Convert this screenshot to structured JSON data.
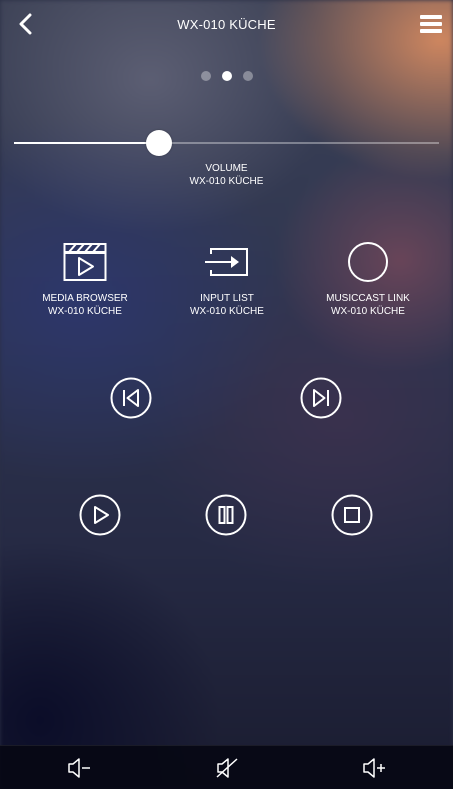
{
  "header": {
    "title": "WX-010 KÜCHE"
  },
  "pager": {
    "count": 3,
    "active_index": 1
  },
  "volume": {
    "level": 0.34,
    "label_line1": "VOLUME",
    "label_line2": "WX-010 KÜCHE"
  },
  "sources": [
    {
      "line1": "MEDIA BROWSER",
      "line2": "WX-010 KÜCHE",
      "icon": "clapperboard-icon"
    },
    {
      "line1": "INPUT LIST",
      "line2": "WX-010 KÜCHE",
      "icon": "input-icon"
    },
    {
      "line1": "MUSICCAST LINK",
      "line2": "WX-010 KÜCHE",
      "icon": "circle-icon"
    }
  ],
  "transport": {
    "icons": [
      "skip-previous-icon",
      "skip-next-icon",
      "play-icon",
      "pause-icon",
      "stop-icon"
    ]
  },
  "bottom_bar": {
    "icons": [
      "volume-down-icon",
      "mute-icon",
      "volume-up-icon"
    ]
  },
  "colors": {
    "foreground": "#ffffff",
    "bottom_bar": "#06081a"
  }
}
